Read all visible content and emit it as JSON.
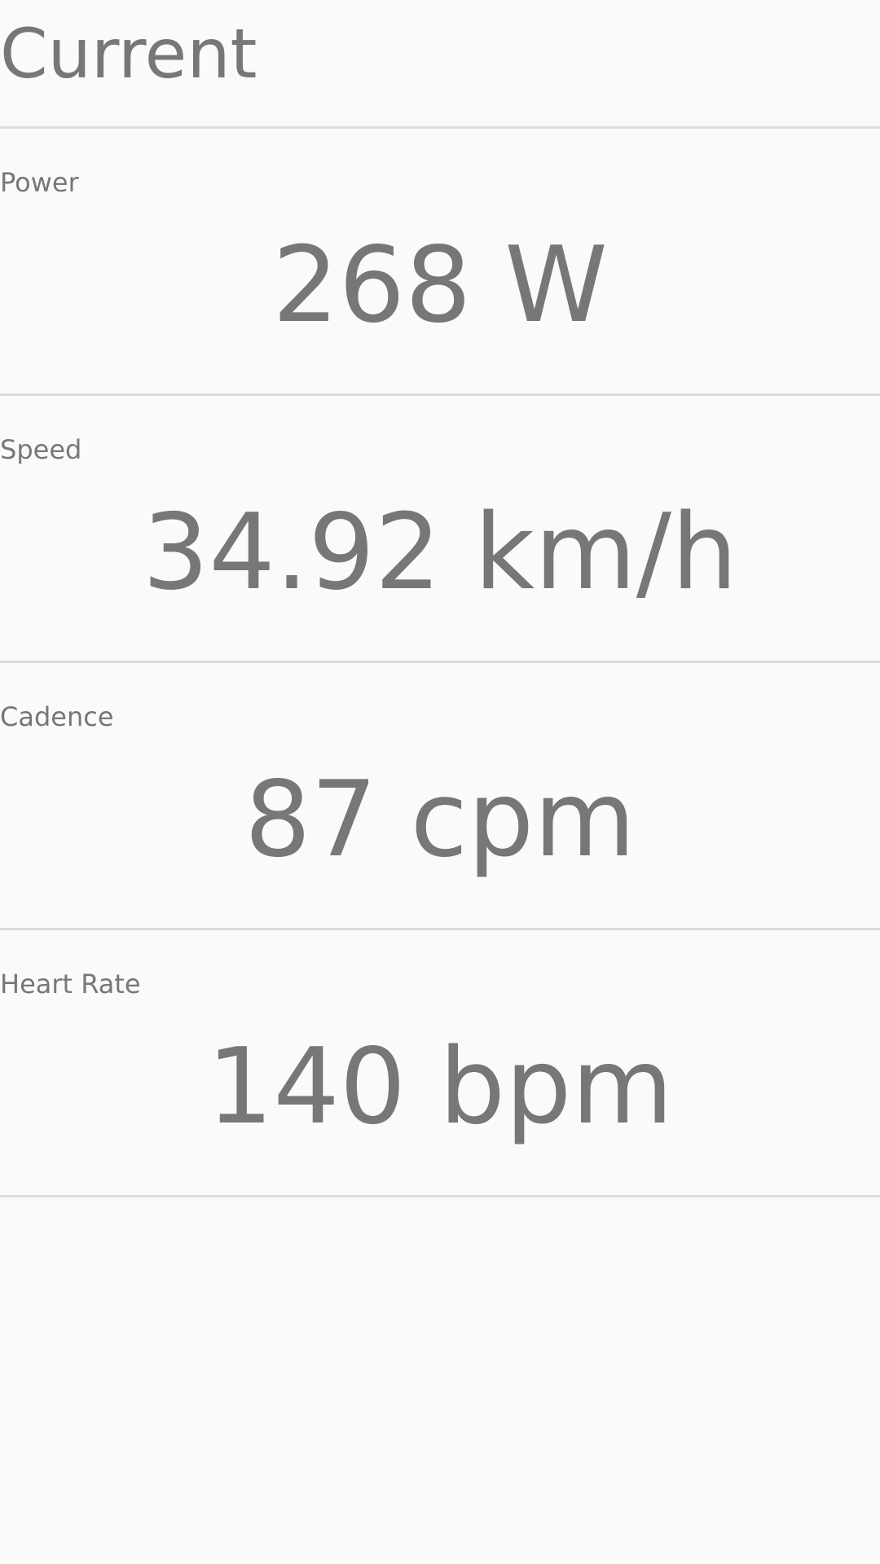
{
  "header": {
    "title": "Current"
  },
  "metrics": [
    {
      "label": "Power",
      "value": "268 W"
    },
    {
      "label": "Speed",
      "value": "34.92 km/h"
    },
    {
      "label": "Cadence",
      "value": "87 cpm"
    },
    {
      "label": "Heart Rate",
      "value": "140 bpm"
    }
  ],
  "colors": {
    "background": "#fafafa",
    "text": "#777777",
    "divider": "#dcdcdc"
  }
}
